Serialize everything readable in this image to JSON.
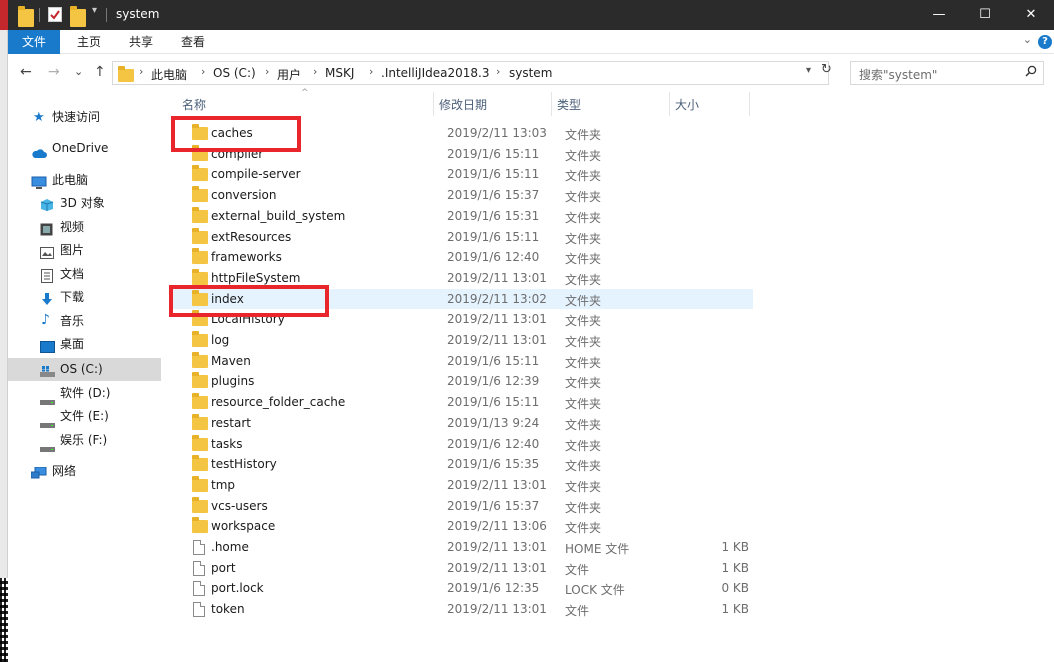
{
  "window": {
    "title": "system",
    "controls": {
      "minimize": "—",
      "maximize": "☐",
      "close": "✕"
    }
  },
  "ribbon": {
    "tabs": [
      {
        "label": "文件",
        "active": true
      },
      {
        "label": "主页",
        "active": false
      },
      {
        "label": "共享",
        "active": false
      },
      {
        "label": "查看",
        "active": false
      }
    ],
    "help": "?"
  },
  "address": {
    "back": "←",
    "forward": "→",
    "recent": "⌄",
    "up": "↑",
    "crumbs": [
      "此电脑",
      "OS (C:)",
      "用户",
      "MSKJ",
      ".IntelliJIdea2018.3",
      "system"
    ],
    "refresh": "↻"
  },
  "search": {
    "placeholder": "搜索\"system\""
  },
  "nav": {
    "items": [
      {
        "label": "快速访问",
        "icon": "star-icon",
        "selected": false
      },
      {
        "label": "OneDrive",
        "icon": "cloud-icon",
        "selected": false
      },
      {
        "label": "此电脑",
        "icon": "computer-icon",
        "selected": false
      },
      {
        "label": "3D 对象",
        "icon": "cube-icon",
        "selected": false
      },
      {
        "label": "视频",
        "icon": "video-icon",
        "selected": false
      },
      {
        "label": "图片",
        "icon": "picture-icon",
        "selected": false
      },
      {
        "label": "文档",
        "icon": "document-icon",
        "selected": false
      },
      {
        "label": "下载",
        "icon": "download-icon",
        "selected": false
      },
      {
        "label": "音乐",
        "icon": "music-icon",
        "selected": false
      },
      {
        "label": "桌面",
        "icon": "desktop-icon",
        "selected": false
      },
      {
        "label": "OS (C:)",
        "icon": "windows-drive-icon",
        "selected": true
      },
      {
        "label": "软件 (D:)",
        "icon": "drive-icon",
        "selected": false
      },
      {
        "label": "文件 (E:)",
        "icon": "drive-icon",
        "selected": false
      },
      {
        "label": "娱乐 (F:)",
        "icon": "drive-icon",
        "selected": false
      },
      {
        "label": "网络",
        "icon": "network-icon",
        "selected": false
      }
    ]
  },
  "list": {
    "columns": {
      "name": "名称",
      "modified": "修改日期",
      "type": "类型",
      "size": "大小"
    },
    "rows": [
      {
        "name": "caches",
        "modified": "2019/2/11 13:03",
        "type": "文件夹",
        "size": "",
        "kind": "folder"
      },
      {
        "name": "compiler",
        "modified": "2019/1/6 15:11",
        "type": "文件夹",
        "size": "",
        "kind": "folder"
      },
      {
        "name": "compile-server",
        "modified": "2019/1/6 15:11",
        "type": "文件夹",
        "size": "",
        "kind": "folder"
      },
      {
        "name": "conversion",
        "modified": "2019/1/6 15:37",
        "type": "文件夹",
        "size": "",
        "kind": "folder"
      },
      {
        "name": "external_build_system",
        "modified": "2019/1/6 15:31",
        "type": "文件夹",
        "size": "",
        "kind": "folder"
      },
      {
        "name": "extResources",
        "modified": "2019/1/6 15:11",
        "type": "文件夹",
        "size": "",
        "kind": "folder"
      },
      {
        "name": "frameworks",
        "modified": "2019/1/6 12:40",
        "type": "文件夹",
        "size": "",
        "kind": "folder"
      },
      {
        "name": "httpFileSystem",
        "modified": "2019/2/11 13:01",
        "type": "文件夹",
        "size": "",
        "kind": "folder"
      },
      {
        "name": "index",
        "modified": "2019/2/11 13:02",
        "type": "文件夹",
        "size": "",
        "kind": "folder",
        "hover": true
      },
      {
        "name": "LocalHistory",
        "modified": "2019/2/11 13:01",
        "type": "文件夹",
        "size": "",
        "kind": "folder"
      },
      {
        "name": "log",
        "modified": "2019/2/11 13:01",
        "type": "文件夹",
        "size": "",
        "kind": "folder"
      },
      {
        "name": "Maven",
        "modified": "2019/1/6 15:11",
        "type": "文件夹",
        "size": "",
        "kind": "folder"
      },
      {
        "name": "plugins",
        "modified": "2019/1/6 12:39",
        "type": "文件夹",
        "size": "",
        "kind": "folder"
      },
      {
        "name": "resource_folder_cache",
        "modified": "2019/1/6 15:11",
        "type": "文件夹",
        "size": "",
        "kind": "folder"
      },
      {
        "name": "restart",
        "modified": "2019/1/13 9:24",
        "type": "文件夹",
        "size": "",
        "kind": "folder"
      },
      {
        "name": "tasks",
        "modified": "2019/1/6 12:40",
        "type": "文件夹",
        "size": "",
        "kind": "folder"
      },
      {
        "name": "testHistory",
        "modified": "2019/1/6 15:35",
        "type": "文件夹",
        "size": "",
        "kind": "folder"
      },
      {
        "name": "tmp",
        "modified": "2019/2/11 13:01",
        "type": "文件夹",
        "size": "",
        "kind": "folder"
      },
      {
        "name": "vcs-users",
        "modified": "2019/1/6 15:37",
        "type": "文件夹",
        "size": "",
        "kind": "folder"
      },
      {
        "name": "workspace",
        "modified": "2019/2/11 13:06",
        "type": "文件夹",
        "size": "",
        "kind": "folder"
      },
      {
        "name": ".home",
        "modified": "2019/2/11 13:01",
        "type": "HOME 文件",
        "size": "1 KB",
        "kind": "file"
      },
      {
        "name": "port",
        "modified": "2019/2/11 13:01",
        "type": "文件",
        "size": "1 KB",
        "kind": "file"
      },
      {
        "name": "port.lock",
        "modified": "2019/1/6 12:35",
        "type": "LOCK 文件",
        "size": "0 KB",
        "kind": "file"
      },
      {
        "name": "token",
        "modified": "2019/2/11 13:01",
        "type": "文件",
        "size": "1 KB",
        "kind": "file"
      }
    ]
  },
  "colors": {
    "accent": "#1979ca",
    "highlight": "#e8262b",
    "folder": "#f4c542",
    "hover": "#e5f3ff"
  }
}
